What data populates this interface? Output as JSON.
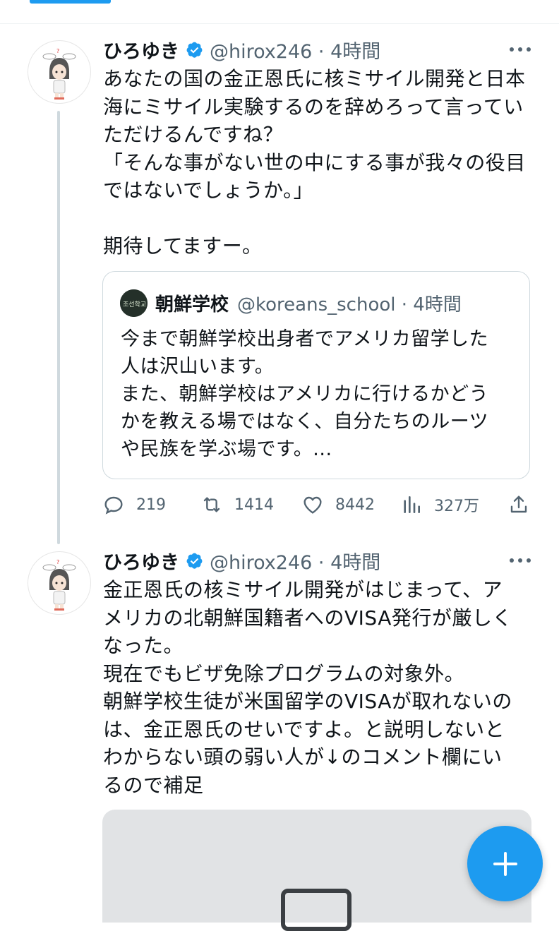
{
  "tweets": [
    {
      "author_name": "ひろゆき",
      "handle_time": "@hirox246 · 4時間",
      "text": "あなたの国の金正恩氏に核ミサイル開発と日本\n海にミサイル実験するのを辞めろって言ってい\nただけるんですね？\n「そんな事がない世の中にする事が我々の役目\nではないでしょうか。」\n\n期待してますー。",
      "quote": {
        "author_name": "朝鮮学校",
        "handle_time": "@koreans_school · 4時間",
        "text": "今まで朝鮮学校出身者でアメリカ留学した\n人は沢山います。\nまた、朝鮮学校はアメリカに行けるかどう\nかを教える場ではなく、自分たちのルーツ\nや民族を学ぶ場です。..."
      },
      "actions": {
        "replies": "219",
        "retweets": "1414",
        "likes": "8442",
        "views": "327万"
      }
    },
    {
      "author_name": "ひろゆき",
      "handle_time": "@hirox246 · 4時間",
      "text": "金正恩氏の核ミサイル開発がはじまって、ア\nメリカの北朝鮮国籍者へのVISA発行が厳しく\nなった。\n現在でもビザ免除プログラムの対象外。\n朝鮮学校生徒が米国留学のVISAが取れないの\nは、金正恩氏のせいですよ。と説明しないと\nわからない頭の弱い人が↓のコメント欄にい\nるので補足"
    }
  ],
  "colors": {
    "accent": "#1d9bf0",
    "text_primary": "#0f1419",
    "text_secondary": "#536471",
    "border": "#cfd9de"
  },
  "icons": [
    "verified-badge-icon",
    "more-icon",
    "reply-icon",
    "retweet-icon",
    "like-icon",
    "views-icon",
    "share-icon",
    "compose-plus-icon"
  ]
}
